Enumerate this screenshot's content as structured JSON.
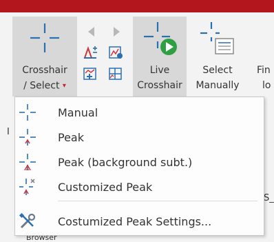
{
  "ribbon": {
    "crosshair_label_line1": "Crosshair",
    "crosshair_label_line2": "/ Select",
    "caret": "▾",
    "live_label_line1": "Live",
    "live_label_line2": "Crosshair",
    "select_label_line1": "Select",
    "select_label_line2": "Manually",
    "find_label_line1": "Fin",
    "find_label_line2": "lo"
  },
  "menu": {
    "items": [
      {
        "label": "Manual",
        "icon": "crosshair-icon"
      },
      {
        "label": "Peak",
        "icon": "crosshair-peak-icon"
      },
      {
        "label": "Peak (background subt.)",
        "icon": "crosshair-peak-bg-icon"
      },
      {
        "label": "Customized Peak",
        "icon": "crosshair-custom-peak-icon"
      },
      {
        "label": "Costumized Peak Settings...",
        "icon": "tools-icon"
      }
    ]
  },
  "background": {
    "left_letter": "I",
    "right_fragment": "S_",
    "bottom_fragment": "Browser"
  },
  "colors": {
    "accent_red": "#b3171d",
    "icon_blue": "#2a6fb0",
    "icon_green": "#2ea043",
    "icon_red": "#d0353b"
  }
}
